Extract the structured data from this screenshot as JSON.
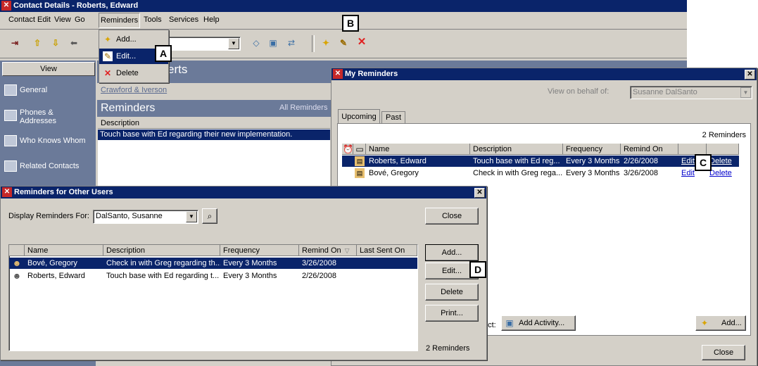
{
  "contact_window": {
    "title": "Contact Details - Roberts, Edward",
    "menu": [
      "Contact",
      "Edit",
      "View",
      "Go",
      "Reminders",
      "Tools",
      "Services",
      "Help"
    ],
    "contact_name_fragment": "erts",
    "company": "Crawford & Iverson",
    "reminders_header": "Reminders",
    "reminders_filter": "All Reminders",
    "description_col": "Description",
    "reminder_row": "Touch base with Ed regarding their new implementation.",
    "view_header": "View",
    "nav": [
      "General",
      "Phones & Addresses",
      "Who Knows Whom",
      "Related Contacts"
    ]
  },
  "reminders_menu": {
    "items": [
      "Add...",
      "Edit...",
      "Delete"
    ]
  },
  "callouts": {
    "a": "A",
    "b": "B",
    "c": "C",
    "d": "D"
  },
  "my_reminders": {
    "title": "My Reminders",
    "behalf_label": "View on behalf of:",
    "behalf_value": "Susanne DalSanto",
    "tabs": [
      "Upcoming",
      "Past"
    ],
    "count": "2 Reminders",
    "columns": [
      "Name",
      "Description",
      "Frequency",
      "Remind On"
    ],
    "rows": [
      {
        "name": "Roberts, Edward",
        "description": "Touch base with Ed reg...",
        "frequency": "Every 3 Months",
        "remind_on": "2/26/2008",
        "edit": "Edit",
        "delete": "Delete"
      },
      {
        "name": "Bové, Gregory",
        "description": "Check in with Greg rega...",
        "frequency": "Every 3 Months",
        "remind_on": "3/26/2008",
        "edit": "Edit",
        "delete": "Delete"
      }
    ],
    "related_label": "ect:",
    "add_activity": "Add Activity...",
    "add": "Add...",
    "close": "Close"
  },
  "other_users": {
    "title": "Reminders for Other Users",
    "display_label": "Display Reminders For:",
    "display_value": "DalSanto, Susanne",
    "close": "Close",
    "columns": [
      "Name",
      "Description",
      "Frequency",
      "Remind On",
      "Last Sent On"
    ],
    "rows": [
      {
        "name": "Bové, Gregory",
        "description": "Check in with Greg regarding th...",
        "frequency": "Every 3 Months",
        "remind_on": "3/26/2008",
        "last_sent": ""
      },
      {
        "name": "Roberts, Edward",
        "description": "Touch base with Ed regarding t...",
        "frequency": "Every 3 Months",
        "remind_on": "2/26/2008",
        "last_sent": ""
      }
    ],
    "buttons": [
      "Add...",
      "Edit...",
      "Delete",
      "Print..."
    ],
    "count": "2 Reminders"
  },
  "colors": {
    "title_bar": "#0a246a",
    "selection": "#0a246a",
    "face": "#d4d0c8",
    "nav_bg": "#6b7a99"
  }
}
